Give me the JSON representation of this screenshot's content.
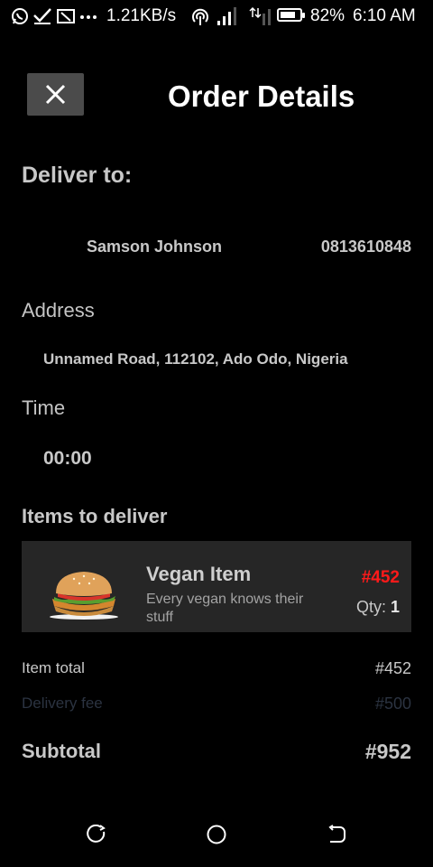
{
  "status_bar": {
    "network_speed": "1.21KB/s",
    "battery_percent_text": "82%",
    "battery_level": 0.82,
    "time": "6:10 AM",
    "left_icons": [
      "whatsapp-icon",
      "check-icon",
      "cast-icon",
      "more-dots-icon"
    ],
    "right_icons": [
      "hotspot-icon",
      "signal-icon",
      "data-icon",
      "battery-icon"
    ]
  },
  "header": {
    "close_icon": "close-icon",
    "title": "Order Details"
  },
  "delivery": {
    "heading": "Deliver to:",
    "customer_name": "Samson Johnson",
    "phone": "0813610848",
    "address_label": "Address",
    "address": "Unnamed Road, 112102, Ado Odo, Nigeria",
    "time_label": "Time",
    "time": "00:00"
  },
  "items": {
    "heading": "Items to deliver",
    "list": [
      {
        "image_icon": "burger-image",
        "name": "Vegan Item",
        "description": "Every vegan knows their stuff",
        "price": "#452",
        "qty_label": "Qty:",
        "qty": "1"
      }
    ]
  },
  "totals": {
    "item_total_label": "Item total",
    "item_total_value": "#452",
    "delivery_fee_label": "Delivery fee",
    "delivery_fee_value": "#500",
    "subtotal_label": "Subtotal",
    "subtotal_value": "#952"
  },
  "colors": {
    "background": "#000000",
    "card": "#262626",
    "close_button": "#4b4b4b",
    "price_red": "#ff1a1a",
    "muted_delivery": "#2b3341"
  },
  "nav_bar": {
    "icons": [
      "recent-apps-icon",
      "home-icon",
      "back-icon"
    ]
  }
}
